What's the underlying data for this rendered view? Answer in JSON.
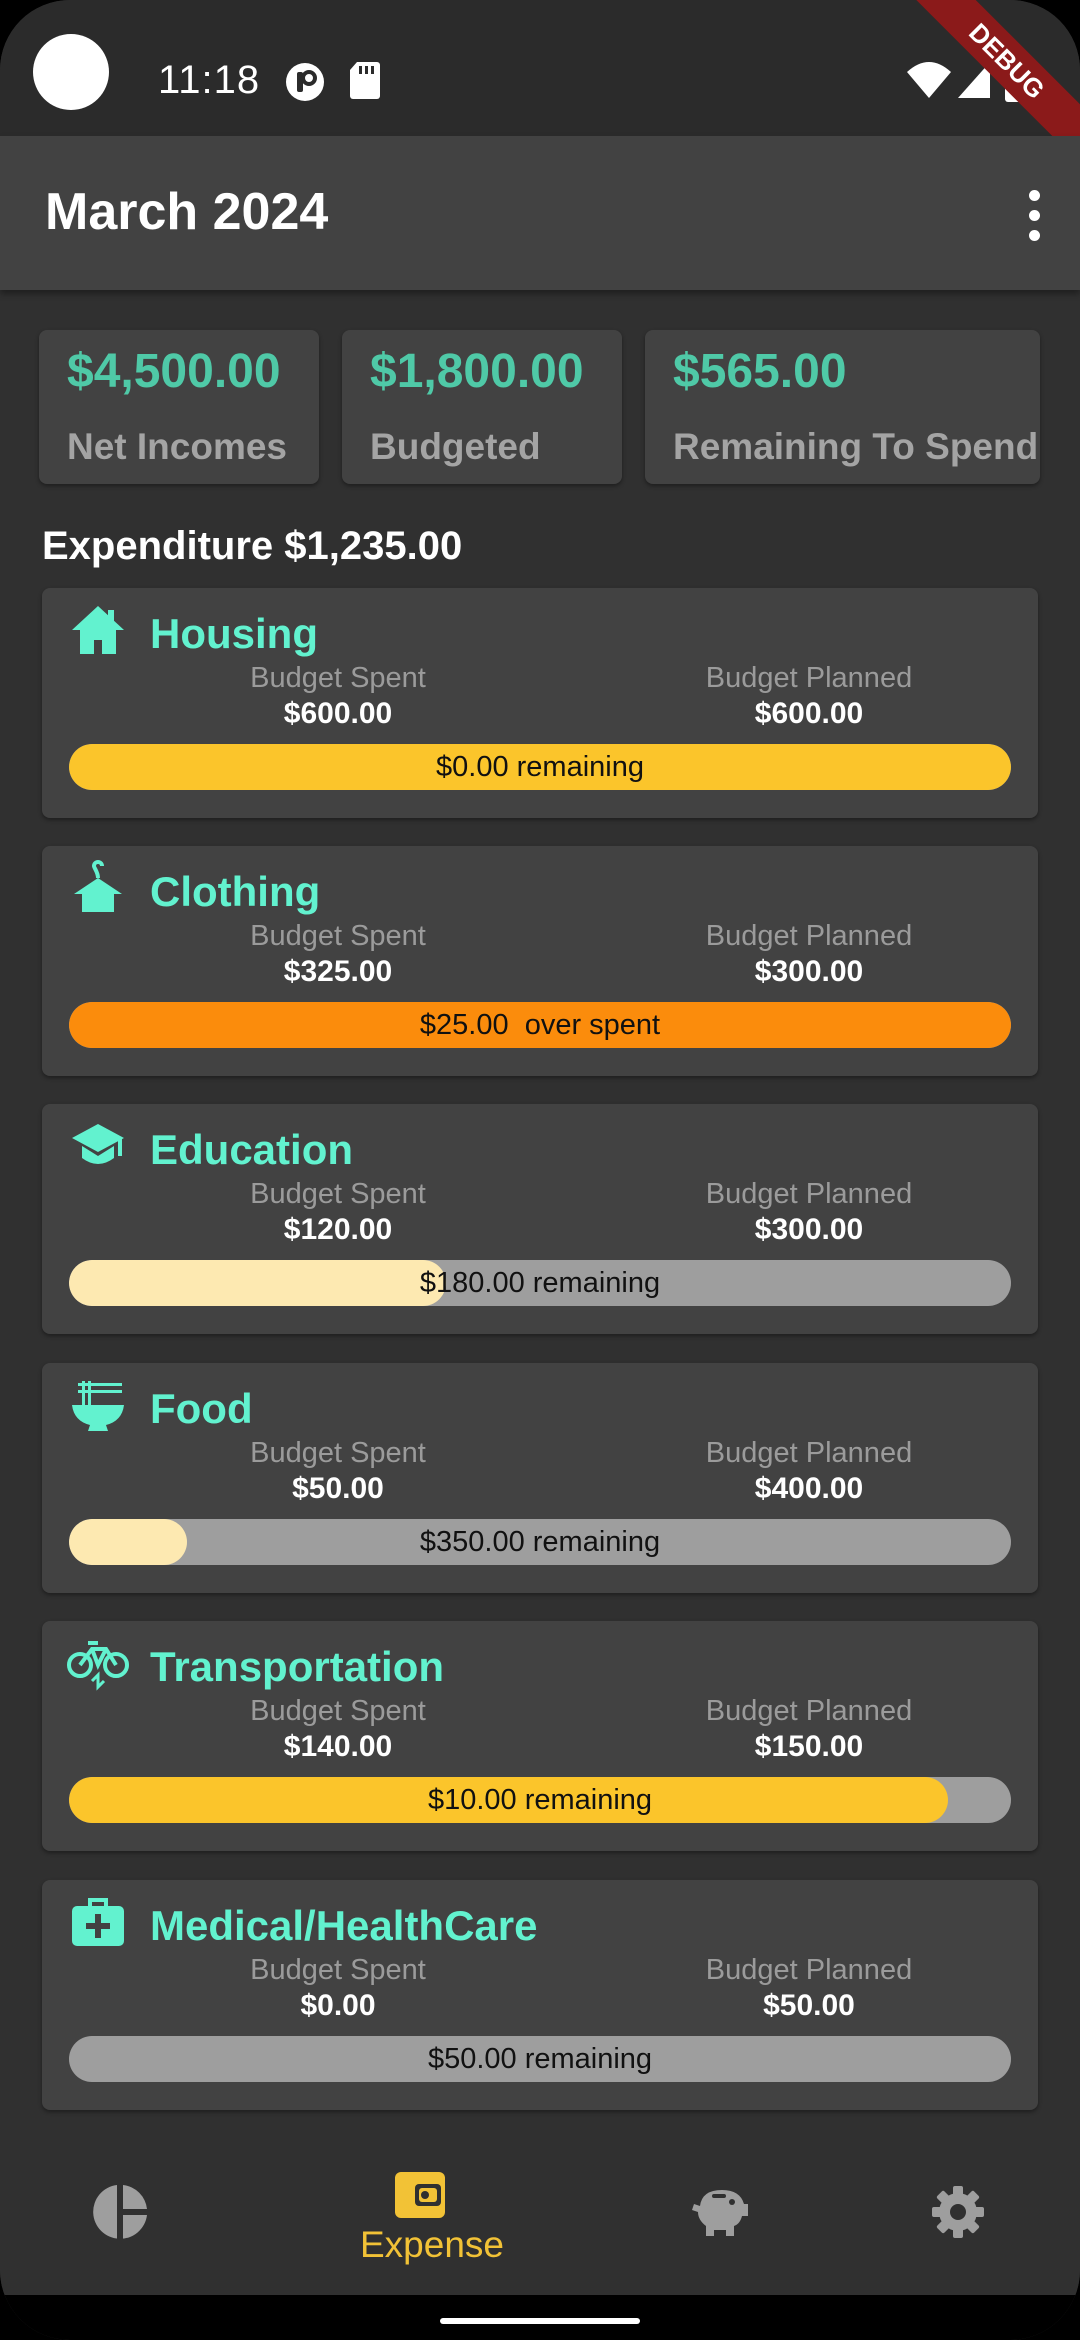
{
  "status_bar": {
    "time": "11:18",
    "debug_banner": "DEBUG"
  },
  "app_bar": {
    "title": "March 2024"
  },
  "summary": [
    {
      "amount": "$4,500.00",
      "label": "Net Incomes"
    },
    {
      "amount": "$1,800.00",
      "label": "Budgeted"
    },
    {
      "amount": "$565.00",
      "label": "Remaining To Spend"
    }
  ],
  "expenditure_label": "Expenditure $1,235.00",
  "categories": [
    {
      "name": "Housing",
      "icon": "house-icon",
      "spent_label": "Budget Spent",
      "spent": "$600.00",
      "planned_label": "Budget Planned",
      "planned": "$600.00",
      "bar_text": "$0.00 remaining",
      "fill_fraction": 1.0,
      "fill_color": "#fbc52b"
    },
    {
      "name": "Clothing",
      "icon": "hanger-icon",
      "spent_label": "Budget Spent",
      "spent": "$325.00",
      "planned_label": "Budget Planned",
      "planned": "$300.00",
      "bar_text": "$25.00  over spent",
      "fill_fraction": 1.0,
      "fill_color": "#fb8c0c"
    },
    {
      "name": "Education",
      "icon": "graduation-cap-icon",
      "spent_label": "Budget Spent",
      "spent": "$120.00",
      "planned_label": "Budget Planned",
      "planned": "$300.00",
      "bar_text": "$180.00 remaining",
      "fill_fraction": 0.4,
      "fill_color": "#fde9b1"
    },
    {
      "name": "Food",
      "icon": "noodle-bowl-icon",
      "spent_label": "Budget Spent",
      "spent": "$50.00",
      "planned_label": "Budget Planned",
      "planned": "$400.00",
      "bar_text": "$350.00 remaining",
      "fill_fraction": 0.125,
      "fill_color": "#fde9b1"
    },
    {
      "name": "Transportation",
      "icon": "bicycle-icon",
      "spent_label": "Budget Spent",
      "spent": "$140.00",
      "planned_label": "Budget Planned",
      "planned": "$150.00",
      "bar_text": "$10.00 remaining",
      "fill_fraction": 0.933,
      "fill_color": "#fbc52b"
    },
    {
      "name": "Medical/HealthCare",
      "icon": "medical-kit-icon",
      "spent_label": "Budget Spent",
      "spent": "$0.00",
      "planned_label": "Budget Planned",
      "planned": "$50.00",
      "bar_text": "$50.00 remaining",
      "fill_fraction": 0.0,
      "fill_color": "#fde9b1"
    }
  ],
  "bottom_nav": {
    "items": [
      {
        "icon": "pie-chart-icon",
        "label": "",
        "active": false
      },
      {
        "icon": "wallet-icon",
        "label": "Expense",
        "active": true
      },
      {
        "icon": "piggy-bank-icon",
        "label": "",
        "active": false
      },
      {
        "icon": "gear-icon",
        "label": "",
        "active": false
      }
    ]
  },
  "colors": {
    "accent_green": "#62f2cf",
    "summary_green": "#4fc9a7",
    "active_nav": "#f2c236",
    "card_bg": "#424242",
    "page_bg": "#303030"
  }
}
